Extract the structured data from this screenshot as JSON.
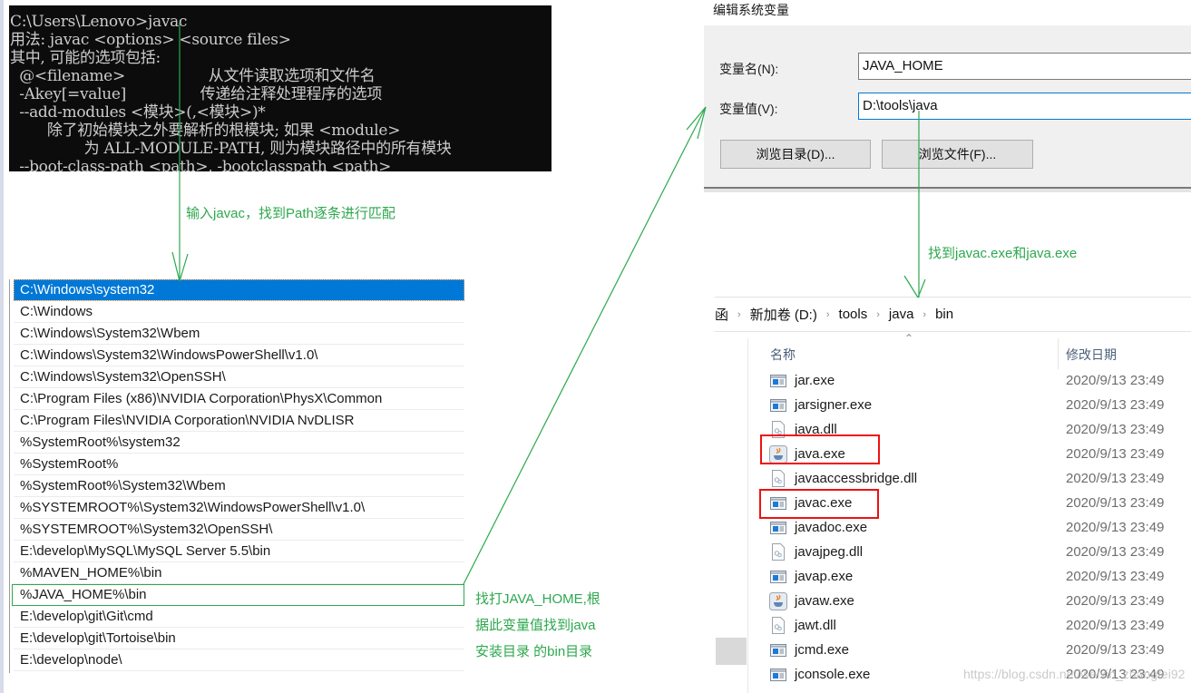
{
  "terminal": {
    "lines": [
      "C:\\Users\\Lenovo>javac",
      "用法: javac <options> <source files>",
      "其中, 可能的选项包括:",
      "  @<filename>                  从文件读取选项和文件名",
      "  -Akey[=value]                传递给注释处理程序的选项",
      "  --add-modules <模块>(,<模块>)*",
      "        除了初始模块之外要解析的根模块; 如果 <module>",
      "                为 ALL-MODULE-PATH, 则为模块路径中的所有模块",
      "  --boot-class-path <path>, -bootclasspath <path>"
    ]
  },
  "annotations": {
    "step1": "输入javac，找到Path逐条进行匹配",
    "step2": [
      "找打JAVA_HOME,根",
      "据此变量值找到java",
      "安装目录 的bin目录"
    ],
    "step3": "找到javac.exe和java.exe"
  },
  "path_list": {
    "selected_index": 0,
    "highlighted_index": 14,
    "items": [
      "C:\\Windows\\system32",
      "C:\\Windows",
      "C:\\Windows\\System32\\Wbem",
      "C:\\Windows\\System32\\WindowsPowerShell\\v1.0\\",
      "C:\\Windows\\System32\\OpenSSH\\",
      "C:\\Program Files (x86)\\NVIDIA Corporation\\PhysX\\Common",
      "C:\\Program Files\\NVIDIA Corporation\\NVIDIA NvDLISR",
      "%SystemRoot%\\system32",
      "%SystemRoot%",
      "%SystemRoot%\\System32\\Wbem",
      "%SYSTEMROOT%\\System32\\WindowsPowerShell\\v1.0\\",
      "%SYSTEMROOT%\\System32\\OpenSSH\\",
      "E:\\develop\\MySQL\\MySQL Server 5.5\\bin",
      "%MAVEN_HOME%\\bin",
      "%JAVA_HOME%\\bin",
      "E:\\develop\\git\\Git\\cmd",
      "E:\\develop\\git\\Tortoise\\bin",
      "E:\\develop\\node\\"
    ]
  },
  "dialog": {
    "title": "编辑系统变量",
    "name_label": "变量名(N):",
    "name_value": "JAVA_HOME",
    "value_label": "变量值(V):",
    "value_value": "D:\\tools\\java",
    "browse_dir_label": "浏览目录(D)...",
    "browse_file_label": "浏览文件(F)..."
  },
  "explorer": {
    "breadcrumb": [
      "函",
      "新加卷 (D:)",
      "tools",
      "java",
      "bin"
    ],
    "columns": {
      "name": "名称",
      "modified": "修改日期"
    },
    "files": [
      {
        "name": "jar.exe",
        "icon": "exe-icon",
        "date": "2020/9/13 23:49"
      },
      {
        "name": "jarsigner.exe",
        "icon": "exe-icon",
        "date": "2020/9/13 23:49"
      },
      {
        "name": "java.dll",
        "icon": "dll-icon",
        "date": "2020/9/13 23:49"
      },
      {
        "name": "java.exe",
        "icon": "java-icon",
        "date": "2020/9/13 23:49",
        "marked": true
      },
      {
        "name": "javaaccessbridge.dll",
        "icon": "dll-icon",
        "date": "2020/9/13 23:49"
      },
      {
        "name": "javac.exe",
        "icon": "exe-icon",
        "date": "2020/9/13 23:49",
        "marked": true
      },
      {
        "name": "javadoc.exe",
        "icon": "exe-icon",
        "date": "2020/9/13 23:49"
      },
      {
        "name": "javajpeg.dll",
        "icon": "dll-icon",
        "date": "2020/9/13 23:49"
      },
      {
        "name": "javap.exe",
        "icon": "exe-icon",
        "date": "2020/9/13 23:49"
      },
      {
        "name": "javaw.exe",
        "icon": "java-icon",
        "date": "2020/9/13 23:49"
      },
      {
        "name": "jawt.dll",
        "icon": "dll-icon",
        "date": "2020/9/13 23:49"
      },
      {
        "name": "jcmd.exe",
        "icon": "exe-icon",
        "date": "2020/9/13 23:49"
      },
      {
        "name": "jconsole.exe",
        "icon": "exe-icon",
        "date": "2020/9/13 23:49"
      }
    ]
  },
  "watermark": "https://blog.csdn.net/weixin_zhangfei92",
  "colors": {
    "annotation_green": "#2ea84f",
    "selection_blue": "#0078d7",
    "marker_red": "#ee1111",
    "terminal_bg": "#0c0c0c"
  }
}
